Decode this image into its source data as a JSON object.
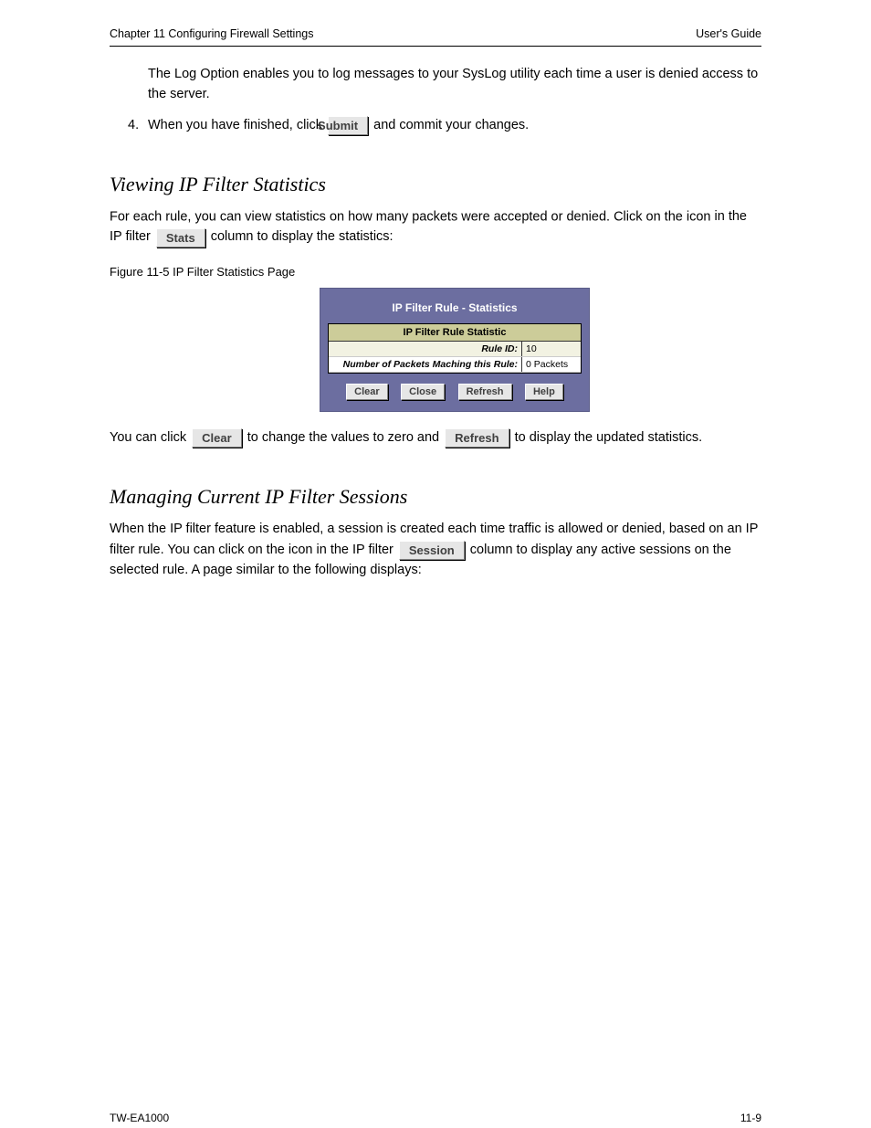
{
  "header": {
    "title_right": "User's Guide",
    "chapter_left": "Chapter 11  Configuring Firewall Settings"
  },
  "buttons": {
    "submit": "Submit",
    "stats": "Stats",
    "clear": "Clear",
    "refresh": "Refresh",
    "session": "Session"
  },
  "text": {
    "p1": "The Log Option enables you to log messages to your SysLog utility each time a user is denied access to the server.",
    "step4_a": "When you have finished, click ",
    "step4_b": " and commit your changes.",
    "section_stats": "Viewing IP Filter Statistics",
    "stats_para_a": "For each rule, you can view statistics on how many packets were accepted or denied. Click on the icon ",
    "stats_para_b": " column to display the statistics:",
    "figcap": "Figure 11-5  IP Filter Statistics Page",
    "under_dialog_a": "You can click ",
    "under_dialog_b": " to change the values to zero and ",
    "under_dialog_c": " to display the updated statistics.",
    "section_session": "Managing Current IP Filter Sessions",
    "session_para_a": "When the IP filter feature is enabled, a session is created each time traffic is allowed or denied, based on an IP filter rule. You can click on the icon ",
    "session_para_b": " column to display any active sessions on the selected rule. A page similar to the following displays:",
    "ipfilter_stats": " in the IP filter "
  },
  "dialog": {
    "title": "IP Filter Rule - Statistics",
    "inner_title": "IP Filter Rule Statistic",
    "rows": [
      {
        "label": "Rule ID:",
        "value": "10"
      },
      {
        "label": "Number of Packets Maching this Rule:",
        "value": "0 Packets"
      }
    ],
    "buttons": {
      "clear": "Clear",
      "close": "Close",
      "refresh": "Refresh",
      "help": "Help"
    }
  },
  "footer": {
    "left": "TW-EA1000",
    "right": "11-9"
  }
}
